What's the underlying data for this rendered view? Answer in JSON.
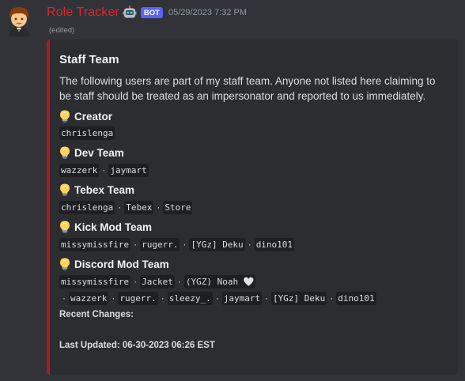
{
  "message": {
    "author": "Role Tracker",
    "bot_badge": "BOT",
    "timestamp": "05/29/2023 7:32 PM",
    "edited": "(edited)"
  },
  "embed": {
    "title": "Staff Team",
    "description": "The following users are part of my staff team. Anyone not listed here claiming to be staff should be treated as an impersonator and reported to us immediately.",
    "fields": [
      {
        "name": "Creator",
        "values": [
          "chrislenga"
        ]
      },
      {
        "name": "Dev Team",
        "values": [
          "wazzerk",
          "jaymart"
        ]
      },
      {
        "name": "Tebex Team",
        "values": [
          "chrislenga",
          "Tebex",
          "Store"
        ]
      },
      {
        "name": "Kick Mod Team",
        "values": [
          "missymissfire",
          "rugerr.",
          "[YGz] Deku",
          "dino101"
        ]
      },
      {
        "name": "Discord Mod Team",
        "values": [
          "missymissfire",
          "Jacket",
          "(YGZ) Noah 🤍",
          "wazzerk",
          "rugerr.",
          "sleezy_.",
          "jaymart",
          "[YGz] Deku",
          "dino101"
        ]
      }
    ],
    "recent_changes": "Recent Changes:",
    "last_updated": "Last Updated: 06-30-2023 06:26 EST",
    "accent_color": "#b5161c"
  },
  "icons": {
    "avatar": "person-avatar",
    "robot": "robot-icon",
    "field": "lightbulb-icon"
  }
}
